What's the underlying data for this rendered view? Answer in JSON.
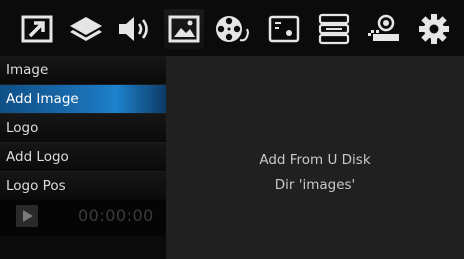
{
  "toolbar": {
    "icons": [
      {
        "name": "expand-icon"
      },
      {
        "name": "layers-icon"
      },
      {
        "name": "speaker-icon"
      },
      {
        "name": "image-icon",
        "active": true
      },
      {
        "name": "film-reel-icon"
      },
      {
        "name": "display-settings-icon"
      },
      {
        "name": "storage-icon"
      },
      {
        "name": "network-icon"
      },
      {
        "name": "gear-icon"
      }
    ]
  },
  "menu": {
    "items": [
      {
        "label": "Image"
      },
      {
        "label": "Add Image",
        "selected": true
      },
      {
        "label": "Logo"
      },
      {
        "label": "Add Logo"
      },
      {
        "label": "Logo Pos"
      }
    ]
  },
  "player": {
    "time": "00:00:00"
  },
  "content": {
    "line1": "Add From U Disk",
    "line2": "Dir 'images'"
  },
  "colors": {
    "selected": "#1c72b8",
    "panel": "#202020",
    "icon": "#e6e6e6"
  }
}
